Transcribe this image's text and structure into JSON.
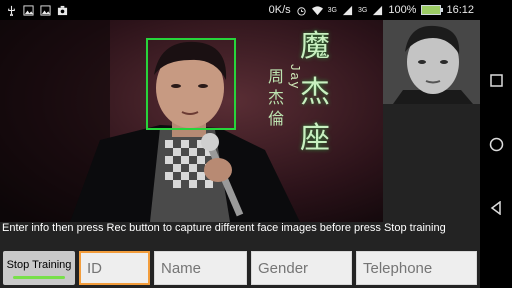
{
  "status_bar": {
    "speed": "0K/s",
    "network": "3G",
    "network2": "3G",
    "battery": "100%",
    "time": "16:12"
  },
  "navigation": {
    "recents": "square-icon",
    "home": "circle-icon",
    "back": "triangle-back-icon"
  },
  "camera": {
    "caption_chars": [
      "魔",
      "杰",
      "座"
    ],
    "name_chars": [
      "周",
      "杰",
      "倫"
    ],
    "name_latin": "Jay"
  },
  "instructions": "Enter info then press Rec button to capture different face images before press Stop training",
  "controls": {
    "train_button": "Stop Training",
    "id_placeholder": "ID",
    "name_placeholder": "Name",
    "gender_placeholder": "Gender",
    "telephone_placeholder": "Telephone"
  },
  "colors": {
    "face_box": "#27d43b",
    "active_field": "#f39d3c",
    "train_indicator": "#78e04a"
  }
}
